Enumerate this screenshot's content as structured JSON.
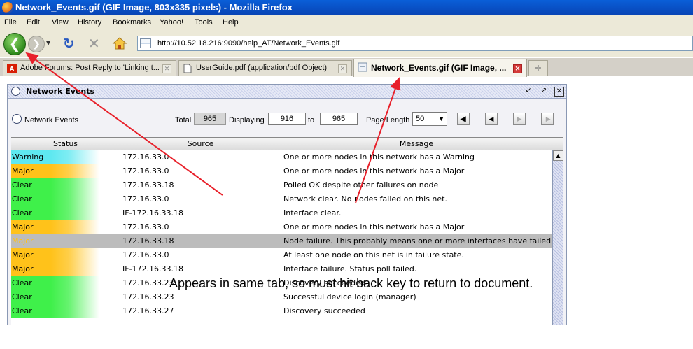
{
  "window": {
    "title": "Network_Events.gif (GIF Image, 803x335 pixels) - Mozilla Firefox"
  },
  "menu": [
    "File",
    "Edit",
    "View",
    "History",
    "Bookmarks",
    "Yahoo!",
    "Tools",
    "Help"
  ],
  "nav": {
    "url": "http://10.52.18.216:9090/help_AT/Network_Events.gif"
  },
  "tabs": [
    {
      "label": "Adobe Forums: Post Reply to 'Linking t...",
      "icon": "adobe-icon"
    },
    {
      "label": "UserGuide.pdf (application/pdf Object)",
      "icon": "document-icon"
    },
    {
      "label": "Network_Events.gif (GIF Image, ...",
      "icon": "image-icon",
      "active": true
    }
  ],
  "panel": {
    "title": "Network Events",
    "toolbar": {
      "title": "Network Events",
      "total_label": "Total",
      "total_value": "965",
      "displaying_label": "Displaying",
      "from_value": "916",
      "to_label": "to",
      "to_value": "965",
      "page_length_label": "Page Length",
      "page_length_value": "50"
    },
    "columns": [
      "Status",
      "Source",
      "Message"
    ],
    "rows": [
      {
        "status": "Warning",
        "source": "172.16.33.0",
        "message": "One or more nodes in this network has a Warning"
      },
      {
        "status": "Major",
        "source": "172.16.33.0",
        "message": "One or more nodes in this network has a Major"
      },
      {
        "status": "Clear",
        "source": "172.16.33.18",
        "message": "Polled OK despite other failures on node"
      },
      {
        "status": "Clear",
        "source": "172.16.33.0",
        "message": "Network clear.  No nodes failed on this net."
      },
      {
        "status": "Clear",
        "source": "IF-172.16.33.18",
        "message": "Interface clear."
      },
      {
        "status": "Major",
        "source": "172.16.33.0",
        "message": "One or more nodes in this network has a Major"
      },
      {
        "status": "Major",
        "source": "172.16.33.18",
        "message": "Node failure.  This probably means one or more interfaces have failed.",
        "selected": true
      },
      {
        "status": "Major",
        "source": "172.16.33.0",
        "message": "At least one node on this net is in failure state."
      },
      {
        "status": "Major",
        "source": "IF-172.16.33.18",
        "message": "Interface failure.  Status poll failed."
      },
      {
        "status": "Clear",
        "source": "172.16.33.23",
        "message": "Discovery succeeded"
      },
      {
        "status": "Clear",
        "source": "172.16.33.23",
        "message": "Successful device login (manager)"
      },
      {
        "status": "Clear",
        "source": "172.16.33.27",
        "message": "Discovery succeeded"
      }
    ]
  },
  "annotation": "Appears in same tab, so must hit back key to return to document.",
  "colors": {
    "warning": "#5ee8f0",
    "major": "#ffc21a",
    "clear": "#3ff04a",
    "selected_row": "#bcbcbc",
    "arrow": "#e8202a"
  }
}
